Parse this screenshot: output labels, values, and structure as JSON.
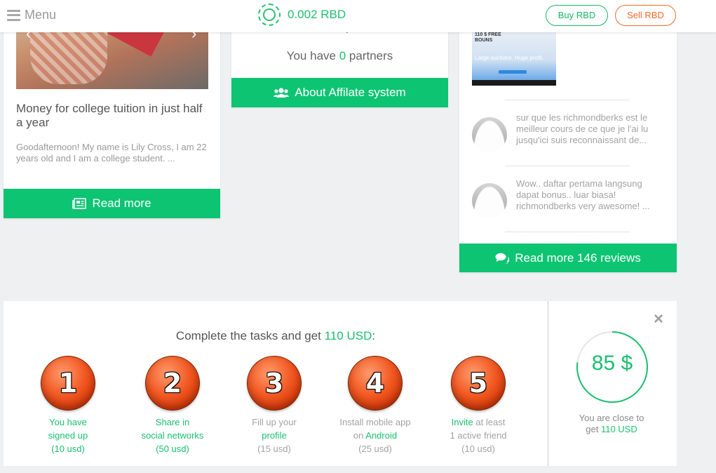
{
  "header": {
    "menu_label": "Menu",
    "balance": "0.002 RBD",
    "buy_label": "Buy RBD",
    "sell_label": "Sell RBD"
  },
  "article": {
    "title": "Money for college tuition in just half a year",
    "excerpt": "Goodafternoon! My name is Lily Cross, I am 22 years old and I am a college student. ...",
    "read_more": "Read more"
  },
  "affiliate": {
    "partners_prefix": "You have",
    "partners_count": "0",
    "partners_suffix": "partners",
    "button_label": "About Affilate system"
  },
  "reviews": {
    "banner_line1": "110 $ FREE",
    "banner_line2": "BOUNS",
    "banner_caption": "Large auctions. Huge profit.",
    "items": [
      {
        "text": "sur que les richmondberks est le meilleur cours de ce que je l'ai lu jusqu'ici suis reconnaissant de..."
      },
      {
        "text": "Wow.. daftar pertama langsung dapat bonus.. luar biasa! richmondberks very awesome! ..."
      }
    ],
    "button_label": "Read more 146 reviews"
  },
  "tasks": {
    "heading_prefix": "Complete the tasks and get",
    "heading_amount": "110 USD",
    "heading_suffix": ":",
    "items": [
      {
        "number": "1",
        "line1_green": "You have",
        "line2_green": "signed up",
        "reward": "(10 usd)"
      },
      {
        "number": "2",
        "line1_green": "Share in",
        "line2_green": "social networks",
        "reward": "(50 usd)"
      },
      {
        "number": "3",
        "line1": "Fill up your",
        "line2_green": "profile",
        "reward": "(15 usd)"
      },
      {
        "number": "4",
        "line1": "Install mobile app",
        "line2_prefix": "on",
        "line2_green": "Android",
        "reward": "(25 usd)"
      },
      {
        "number": "5",
        "line1_green": "Invite",
        "line1_rest": "at least",
        "line2": "1 active friend",
        "reward": "(10 usd)"
      }
    ],
    "progress_amount": "85 $",
    "progress_fraction": 0.77,
    "close_prefix": "You are close to",
    "close_get": "get",
    "close_amount": "110 USD"
  },
  "colors": {
    "accent_green": "#0dc473",
    "sell_orange": "#f26b2a"
  }
}
